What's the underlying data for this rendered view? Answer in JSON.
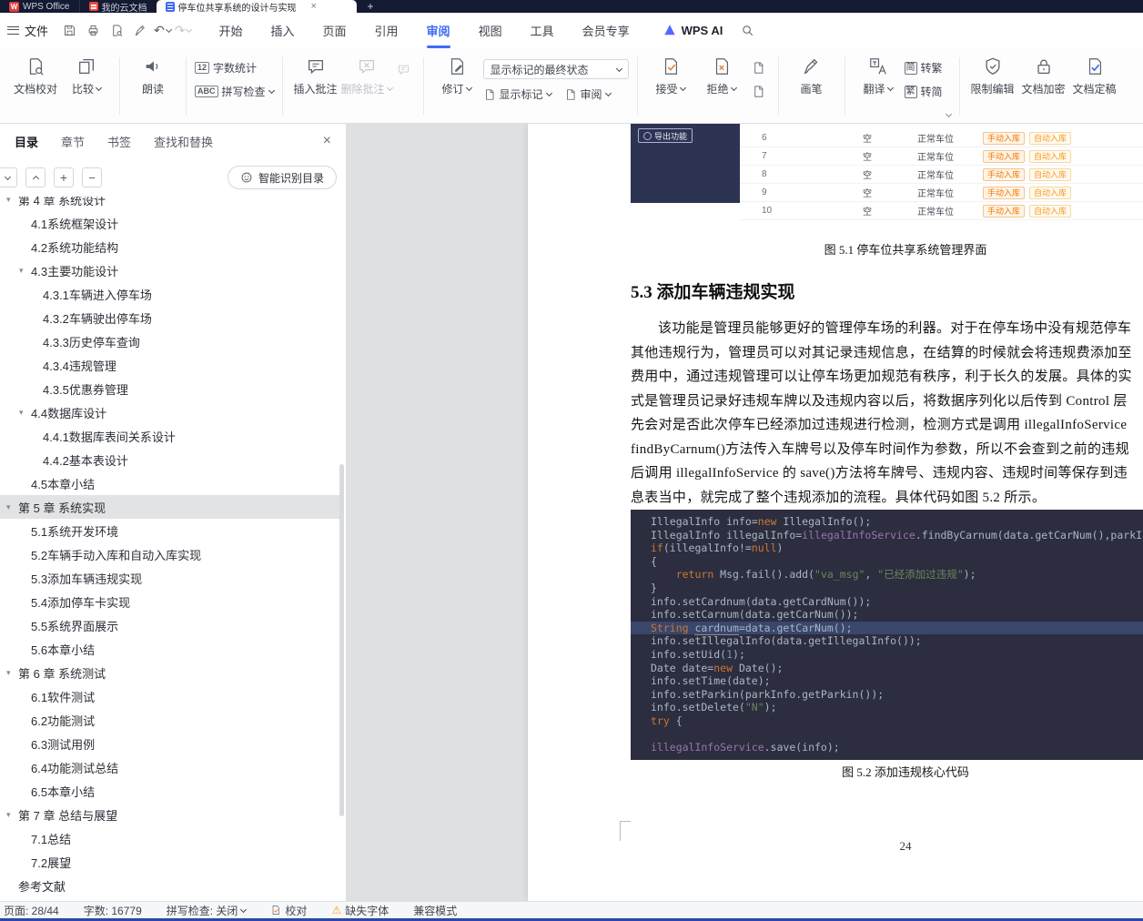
{
  "colors": {
    "accent": "#3f6bf5",
    "tabbar_bg": "#151a33",
    "toc_selected_bg": "#e2e3e5",
    "code_bg": "#2c2d3f",
    "code_text": "#a9b7c6",
    "code_keyword": "#cc7832",
    "code_string": "#6a8759",
    "code_number": "#6897bb",
    "code_field": "#9876aa",
    "badge_orange": "#f07a00",
    "warning": "#ff9f1a"
  },
  "tabbar": {
    "app_tab": "WPS Office",
    "logo_glyph": "W",
    "tabs": [
      "我的云文档",
      "停车位共享系统的设计与实现"
    ],
    "new_tab": "+"
  },
  "menubar": {
    "file": "文件",
    "menus": [
      "开始",
      "插入",
      "页面",
      "引用",
      "审阅",
      "视图",
      "工具",
      "会员专享"
    ],
    "active_menu": "审阅",
    "ai_label": "WPS AI"
  },
  "ribbon": {
    "doc_proof": "文档校对",
    "compare": "比较",
    "read_aloud": "朗读",
    "word_count": "字数统计",
    "word_count_icon": "12",
    "spell_check": "拼写检查",
    "spell_icon": "ABC",
    "insert_comment": "插入批注",
    "delete_comment": "删除批注",
    "revise": "修订",
    "markup_state": "显示标记的最终状态",
    "show_markup": "显示标记",
    "review": "审阅",
    "accept": "接受",
    "reject": "拒绝",
    "brush": "画笔",
    "translate": "翻译",
    "to_trad": "转繁",
    "to_trad_icon": "简",
    "to_simp": "转简",
    "to_simp_icon": "繁",
    "restrict_edit": "限制编辑",
    "doc_encrypt": "文档加密",
    "doc_finalize": "文档定稿"
  },
  "panel": {
    "tabs": [
      "目录",
      "章节",
      "书签",
      "查找和替换"
    ],
    "active_tab": "目录",
    "smart_toc": "智能识别目录",
    "toc": [
      {
        "t": "第 4 章 系统设计",
        "l": 1,
        "e": 1
      },
      {
        "t": "4.1系统框架设计",
        "l": 2
      },
      {
        "t": "4.2系统功能结构",
        "l": 2
      },
      {
        "t": "4.3主要功能设计",
        "l": 2,
        "e": 1
      },
      {
        "t": "4.3.1车辆进入停车场",
        "l": 3
      },
      {
        "t": "4.3.2车辆驶出停车场",
        "l": 3
      },
      {
        "t": "4.3.3历史停车查询",
        "l": 3
      },
      {
        "t": "4.3.4违规管理",
        "l": 3
      },
      {
        "t": "4.3.5优惠券管理",
        "l": 3
      },
      {
        "t": "4.4数据库设计",
        "l": 2,
        "e": 1
      },
      {
        "t": "4.4.1数据库表间关系设计",
        "l": 3
      },
      {
        "t": "4.4.2基本表设计",
        "l": 3
      },
      {
        "t": "4.5本章小结",
        "l": 2
      },
      {
        "t": "第 5 章 系统实现",
        "l": 1,
        "e": 1,
        "sel": 1
      },
      {
        "t": "5.1系统开发环境",
        "l": 2
      },
      {
        "t": "5.2车辆手动入库和自动入库实现",
        "l": 2
      },
      {
        "t": "5.3添加车辆违规实现",
        "l": 2
      },
      {
        "t": "5.4添加停车卡实现",
        "l": 2
      },
      {
        "t": "5.5系统界面展示",
        "l": 2
      },
      {
        "t": "5.6本章小结",
        "l": 2
      },
      {
        "t": "第 6 章 系统测试",
        "l": 1,
        "e": 1
      },
      {
        "t": "6.1软件测试",
        "l": 2
      },
      {
        "t": "6.2功能测试",
        "l": 2
      },
      {
        "t": "6.3测试用例",
        "l": 2
      },
      {
        "t": "6.4功能测试总结",
        "l": 2
      },
      {
        "t": "6.5本章小结",
        "l": 2
      },
      {
        "t": "第 7 章 总结与展望",
        "l": 1,
        "e": 1
      },
      {
        "t": "7.1总结",
        "l": 2
      },
      {
        "t": "7.2展望",
        "l": 2
      },
      {
        "t": "参考文献",
        "l": 1
      }
    ]
  },
  "document": {
    "figure1": {
      "sidebar_button": "导出功能",
      "row_numbers": [
        "6",
        "7",
        "8",
        "9",
        "10"
      ],
      "columns": {
        "empty": "空",
        "status": "正常车位",
        "badge1": "手动入库",
        "badge2": "自动入库"
      },
      "caption": "图 5.1 停车位共享系统管理界面"
    },
    "heading": "5.3  添加车辆违规实现",
    "body_lines": [
      "该功能是管理员能够更好的管理停车场的利器。对于在停车场中没有规范停车",
      "其他违规行为，管理员可以对其记录违规信息，在结算的时候就会将违规费添加至",
      "费用中，通过违规管理可以让停车场更加规范有秩序，利于长久的发展。具体的实",
      "式是管理员记录好违规车牌以及违规内容以后，将数据序列化以后传到 Control 层",
      "先会对是否此次停车已经添加过违规进行检测，检测方式是调用 illegalInfoService",
      "findByCarnum()方法传入车牌号以及停车时间作为参数，所以不会查到之前的违规",
      "后调用 illegalInfoService 的 save()方法将车牌号、违规内容、违规时间等保存到违",
      "息表当中，就完成了整个违规添加的流程。具体代码如图 5.2 所示。"
    ],
    "code": [
      {
        "s": [
          [
            "p",
            "IllegalInfo info="
          ],
          [
            "k",
            "new"
          ],
          [
            "p",
            " IllegalInfo();"
          ]
        ]
      },
      {
        "s": [
          [
            "p",
            "IllegalInfo illegalInfo="
          ],
          [
            "f",
            "illegalInfoService"
          ],
          [
            "p",
            ".findByCarnum(data.getCarNum(),parkInfo.getParki"
          ]
        ]
      },
      {
        "s": [
          [
            "k",
            "if"
          ],
          [
            "p",
            "(illegalInfo!="
          ],
          [
            "k",
            "null"
          ],
          [
            "p",
            ")"
          ]
        ]
      },
      {
        "s": [
          [
            "p",
            "{"
          ]
        ]
      },
      {
        "s": [
          [
            "p",
            "    "
          ],
          [
            "k",
            "return"
          ],
          [
            "p",
            " Msg.fail().add("
          ],
          [
            "s2",
            "\"va_msg\""
          ],
          [
            "p",
            ", "
          ],
          [
            "s2",
            "\"已经添加过违规\""
          ],
          [
            "p",
            ");"
          ]
        ]
      },
      {
        "s": [
          [
            "p",
            "}"
          ]
        ]
      },
      {
        "s": [
          [
            "p",
            "info.setCardnum(data.getCardNum());"
          ]
        ]
      },
      {
        "s": [
          [
            "p",
            "info.setCarnum(data.getCarNum());"
          ]
        ]
      },
      {
        "h": 1,
        "s": [
          [
            "k",
            "String"
          ],
          [
            "p",
            " "
          ],
          [
            "u",
            "cardnum"
          ],
          [
            "p",
            "=data.getCarNum();"
          ]
        ]
      },
      {
        "s": [
          [
            "p",
            "info.setIllegalInfo(data.getIllegalInfo());"
          ]
        ]
      },
      {
        "s": [
          [
            "p",
            "info.setUid("
          ],
          [
            "n",
            "1"
          ],
          [
            "p",
            ");"
          ]
        ]
      },
      {
        "s": [
          [
            "p",
            "Date date="
          ],
          [
            "k",
            "new"
          ],
          [
            "p",
            " Date();"
          ]
        ]
      },
      {
        "s": [
          [
            "p",
            "info.setTime(date);"
          ]
        ]
      },
      {
        "s": [
          [
            "p",
            "info.setParkin(parkInfo.getParkin());"
          ]
        ]
      },
      {
        "s": [
          [
            "p",
            "info.setDelete("
          ],
          [
            "s2",
            "\"N\""
          ],
          [
            "p",
            ");"
          ]
        ]
      },
      {
        "s": [
          [
            "k",
            "try"
          ],
          [
            "p",
            " {"
          ]
        ]
      },
      {
        "s": []
      },
      {
        "s": [
          [
            "f",
            "illegalInfoService"
          ],
          [
            "p",
            ".save(info);"
          ]
        ]
      }
    ],
    "figure2_caption": "图 5.2 添加违规核心代码",
    "page_number": "24"
  },
  "statusbar": {
    "page": "页面: 28/44",
    "words": "字数: 16779",
    "spell": "拼写检查: 关闭",
    "proof": "校对",
    "missing_font": "缺失字体",
    "compat": "兼容模式"
  }
}
